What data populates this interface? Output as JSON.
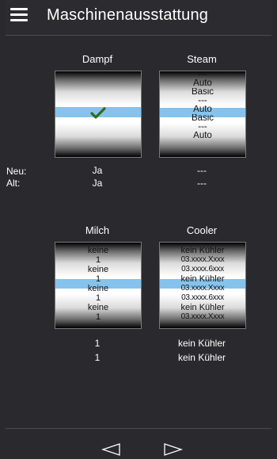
{
  "header": {
    "title": "Maschinenausstattung"
  },
  "top": {
    "dampf": {
      "label": "Dampf"
    },
    "steam": {
      "label": "Steam",
      "options": [
        "---",
        "Auto",
        "Basic",
        "---",
        "Auto",
        "Basic",
        "---",
        "Auto"
      ]
    },
    "rows": {
      "neu_label": "Neu:",
      "alt_label": "Alt:",
      "dampf_neu": "Ja",
      "dampf_alt": "Ja",
      "steam_neu": "---",
      "steam_alt": "---"
    }
  },
  "bottom": {
    "milch": {
      "label": "Milch",
      "options": [
        "keine",
        "1",
        "keine",
        "1",
        "keine",
        "1",
        "keine",
        "1"
      ]
    },
    "cooler": {
      "label": "Cooler",
      "options": [
        "kein Kühler",
        "03.xxxx.Xxxx",
        "03.xxxx.6xxx",
        "kein Kühler",
        "03.xxxx.Xxxx",
        "03.xxxx.6xxx",
        "kein Kühler",
        "03.xxxx.Xxxx"
      ]
    },
    "rows": {
      "milch_neu": "1",
      "milch_alt": "1",
      "cooler_neu": "kein Kühler",
      "cooler_alt": "kein Kühler"
    }
  },
  "footer": {
    "prev_icon": "triangle-left-icon",
    "next_icon": "triangle-right-icon"
  },
  "colors": {
    "background": "#2a2a2e",
    "selection": "#86c3ec",
    "check": "#2f6b1e"
  }
}
